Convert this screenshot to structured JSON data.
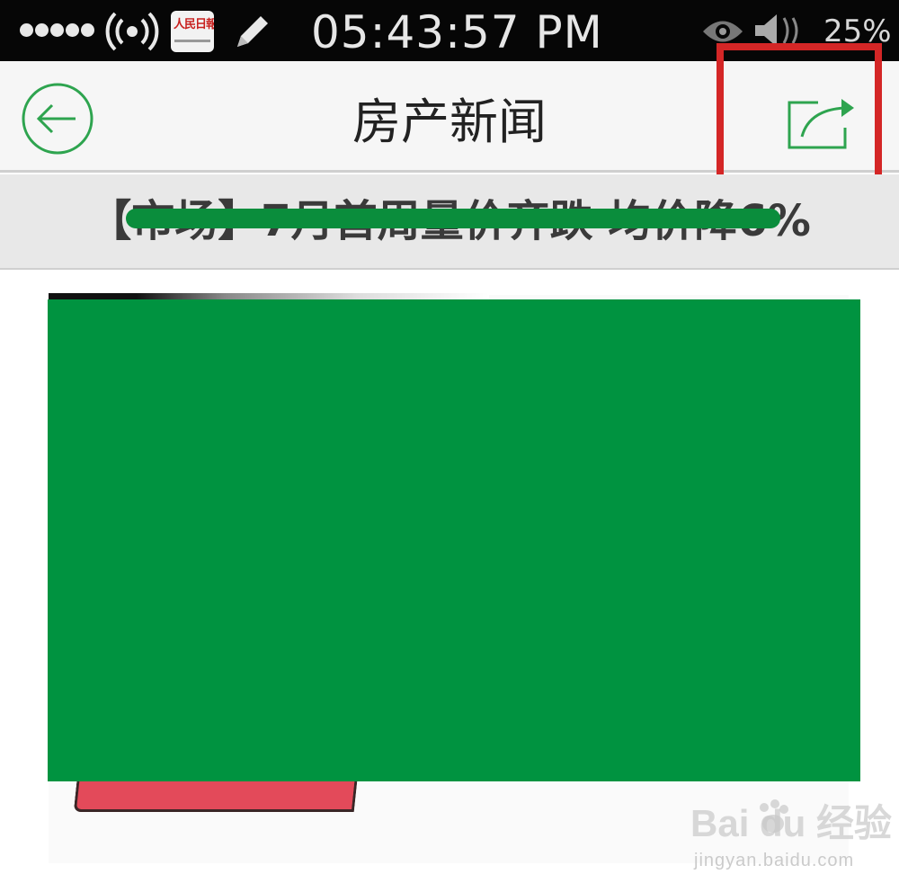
{
  "status_bar": {
    "time": "05:43:57 PM",
    "battery": "25%",
    "app_badge_text": "人民日報",
    "icons": [
      "signal-dots-icon",
      "wifi-icon",
      "people-daily-app-icon",
      "pencil-icon",
      "eye-icon",
      "mute-icon"
    ]
  },
  "nav": {
    "title": "房产新闻",
    "back_icon": "back-arrow-circle-icon",
    "share_icon": "share-arrow-icon"
  },
  "headline": {
    "text": "【市场】7月首周量价齐跌 均价降6%"
  },
  "watermark": {
    "logo_text": "Bai du 经验",
    "url": "jingyan.baidu.com"
  },
  "colors": {
    "accent_green": "#009340",
    "highlight_red": "#d42626"
  }
}
